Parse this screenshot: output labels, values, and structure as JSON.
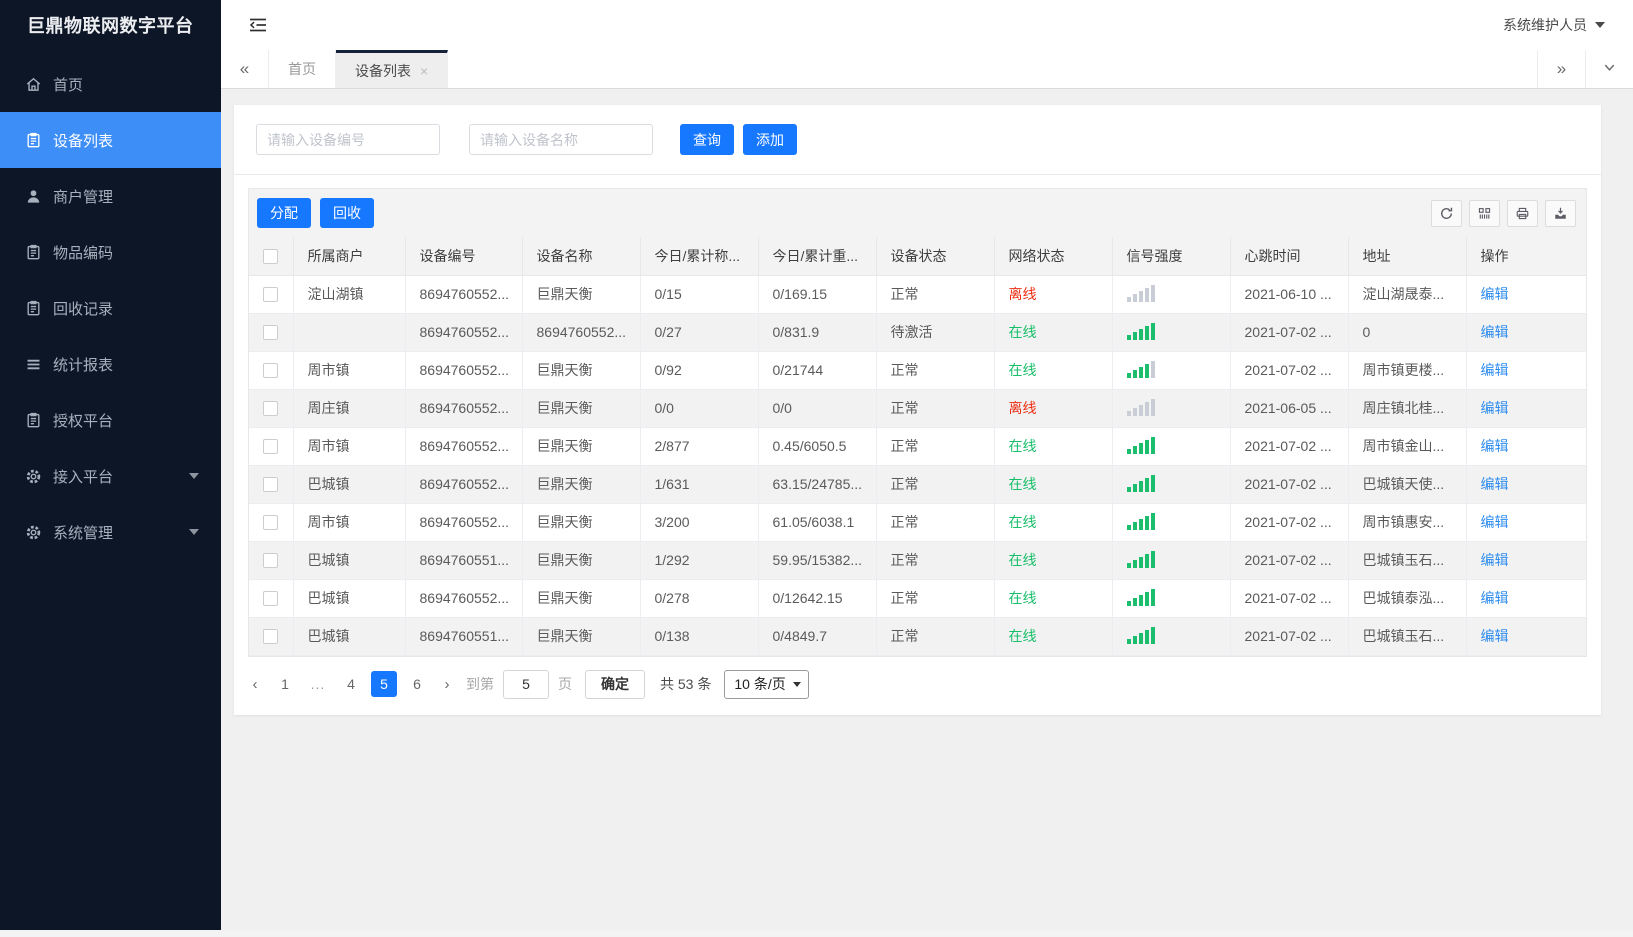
{
  "colors": {
    "primary": "#1677ff",
    "sidebar_bg": "#0d1626",
    "sidebar_active": "#3e8ef7",
    "online": "#19be6b",
    "offline": "#ed2f14",
    "link": "#2d8cf0"
  },
  "app": {
    "logo": "巨鼎物联网数字平台",
    "user": "系统维护人员"
  },
  "sidebar": {
    "items": [
      {
        "label": "首页",
        "icon": "home",
        "active": false,
        "expandable": false
      },
      {
        "label": "设备列表",
        "icon": "clipboard",
        "active": true,
        "expandable": false
      },
      {
        "label": "商户管理",
        "icon": "user",
        "active": false,
        "expandable": false
      },
      {
        "label": "物品编码",
        "icon": "clipboard",
        "active": false,
        "expandable": false
      },
      {
        "label": "回收记录",
        "icon": "clipboard",
        "active": false,
        "expandable": false
      },
      {
        "label": "统计报表",
        "icon": "list",
        "active": false,
        "expandable": false
      },
      {
        "label": "授权平台",
        "icon": "clipboard",
        "active": false,
        "expandable": false
      },
      {
        "label": "接入平台",
        "icon": "gear",
        "active": false,
        "expandable": true
      },
      {
        "label": "系统管理",
        "icon": "gear",
        "active": false,
        "expandable": true
      }
    ]
  },
  "tabbar": {
    "tabs": [
      {
        "label": "首页",
        "active": false,
        "closable": false
      },
      {
        "label": "设备列表",
        "active": true,
        "closable": true
      }
    ]
  },
  "search": {
    "device_no_placeholder": "请输入设备编号",
    "device_name_placeholder": "请输入设备名称",
    "query_label": "查询",
    "add_label": "添加"
  },
  "grid": {
    "assign_label": "分配",
    "recycle_label": "回收",
    "tool_icons": [
      "refresh",
      "columns",
      "print",
      "export"
    ]
  },
  "table": {
    "columns": [
      "所属商户",
      "设备编号",
      "设备名称",
      "今日/累计称...",
      "今日/累计重...",
      "设备状态",
      "网络状态",
      "信号强度",
      "心跳时间",
      "地址",
      "操作"
    ],
    "rows": [
      {
        "merchant": "淀山湖镇",
        "device_no": "8694760552...",
        "device_name": "巨鼎天衡",
        "today_count": "0/15",
        "today_weight": "0/169.15",
        "device_status": "正常",
        "network_status": "离线",
        "online": false,
        "signal_bars": 0,
        "heartbeat": "2021-06-10 ...",
        "address": "淀山湖晟泰...",
        "action": "编辑"
      },
      {
        "merchant": "",
        "device_no": "8694760552...",
        "device_name": "8694760552...",
        "today_count": "0/27",
        "today_weight": "0/831.9",
        "device_status": "待激活",
        "network_status": "在线",
        "online": true,
        "signal_bars": 5,
        "heartbeat": "2021-07-02 ...",
        "address": "0",
        "action": "编辑"
      },
      {
        "merchant": "周市镇",
        "device_no": "8694760552...",
        "device_name": "巨鼎天衡",
        "today_count": "0/92",
        "today_weight": "0/21744",
        "device_status": "正常",
        "network_status": "在线",
        "online": true,
        "signal_bars": 4,
        "heartbeat": "2021-07-02 ...",
        "address": "周市镇更楼...",
        "action": "编辑"
      },
      {
        "merchant": "周庄镇",
        "device_no": "8694760552...",
        "device_name": "巨鼎天衡",
        "today_count": "0/0",
        "today_weight": "0/0",
        "device_status": "正常",
        "network_status": "离线",
        "online": false,
        "signal_bars": 0,
        "heartbeat": "2021-06-05 ...",
        "address": "周庄镇北桂...",
        "action": "编辑"
      },
      {
        "merchant": "周市镇",
        "device_no": "8694760552...",
        "device_name": "巨鼎天衡",
        "today_count": "2/877",
        "today_weight": "0.45/6050.5",
        "device_status": "正常",
        "network_status": "在线",
        "online": true,
        "signal_bars": 5,
        "heartbeat": "2021-07-02 ...",
        "address": "周市镇金山...",
        "action": "编辑"
      },
      {
        "merchant": "巴城镇",
        "device_no": "8694760552...",
        "device_name": "巨鼎天衡",
        "today_count": "1/631",
        "today_weight": "63.15/24785...",
        "device_status": "正常",
        "network_status": "在线",
        "online": true,
        "signal_bars": 5,
        "heartbeat": "2021-07-02 ...",
        "address": "巴城镇天使...",
        "action": "编辑"
      },
      {
        "merchant": "周市镇",
        "device_no": "8694760552...",
        "device_name": "巨鼎天衡",
        "today_count": "3/200",
        "today_weight": "61.05/6038.1",
        "device_status": "正常",
        "network_status": "在线",
        "online": true,
        "signal_bars": 5,
        "heartbeat": "2021-07-02 ...",
        "address": "周市镇惠安...",
        "action": "编辑"
      },
      {
        "merchant": "巴城镇",
        "device_no": "8694760551...",
        "device_name": "巨鼎天衡",
        "today_count": "1/292",
        "today_weight": "59.95/15382...",
        "device_status": "正常",
        "network_status": "在线",
        "online": true,
        "signal_bars": 5,
        "heartbeat": "2021-07-02 ...",
        "address": "巴城镇玉石...",
        "action": "编辑"
      },
      {
        "merchant": "巴城镇",
        "device_no": "8694760552...",
        "device_name": "巨鼎天衡",
        "today_count": "0/278",
        "today_weight": "0/12642.15",
        "device_status": "正常",
        "network_status": "在线",
        "online": true,
        "signal_bars": 5,
        "heartbeat": "2021-07-02 ...",
        "address": "巴城镇泰泓...",
        "action": "编辑"
      },
      {
        "merchant": "巴城镇",
        "device_no": "8694760551...",
        "device_name": "巨鼎天衡",
        "today_count": "0/138",
        "today_weight": "0/4849.7",
        "device_status": "正常",
        "network_status": "在线",
        "online": true,
        "signal_bars": 5,
        "heartbeat": "2021-07-02 ...",
        "address": "巴城镇玉石...",
        "action": "编辑"
      }
    ]
  },
  "pagination": {
    "pages": [
      "1",
      "...",
      "4",
      "5",
      "6"
    ],
    "active": "5",
    "goto_label": "到第",
    "goto_value": "5",
    "page_unit_label": "页",
    "confirm_label": "确定",
    "total_label": "共 53 条",
    "page_size_label": "10 条/页"
  }
}
